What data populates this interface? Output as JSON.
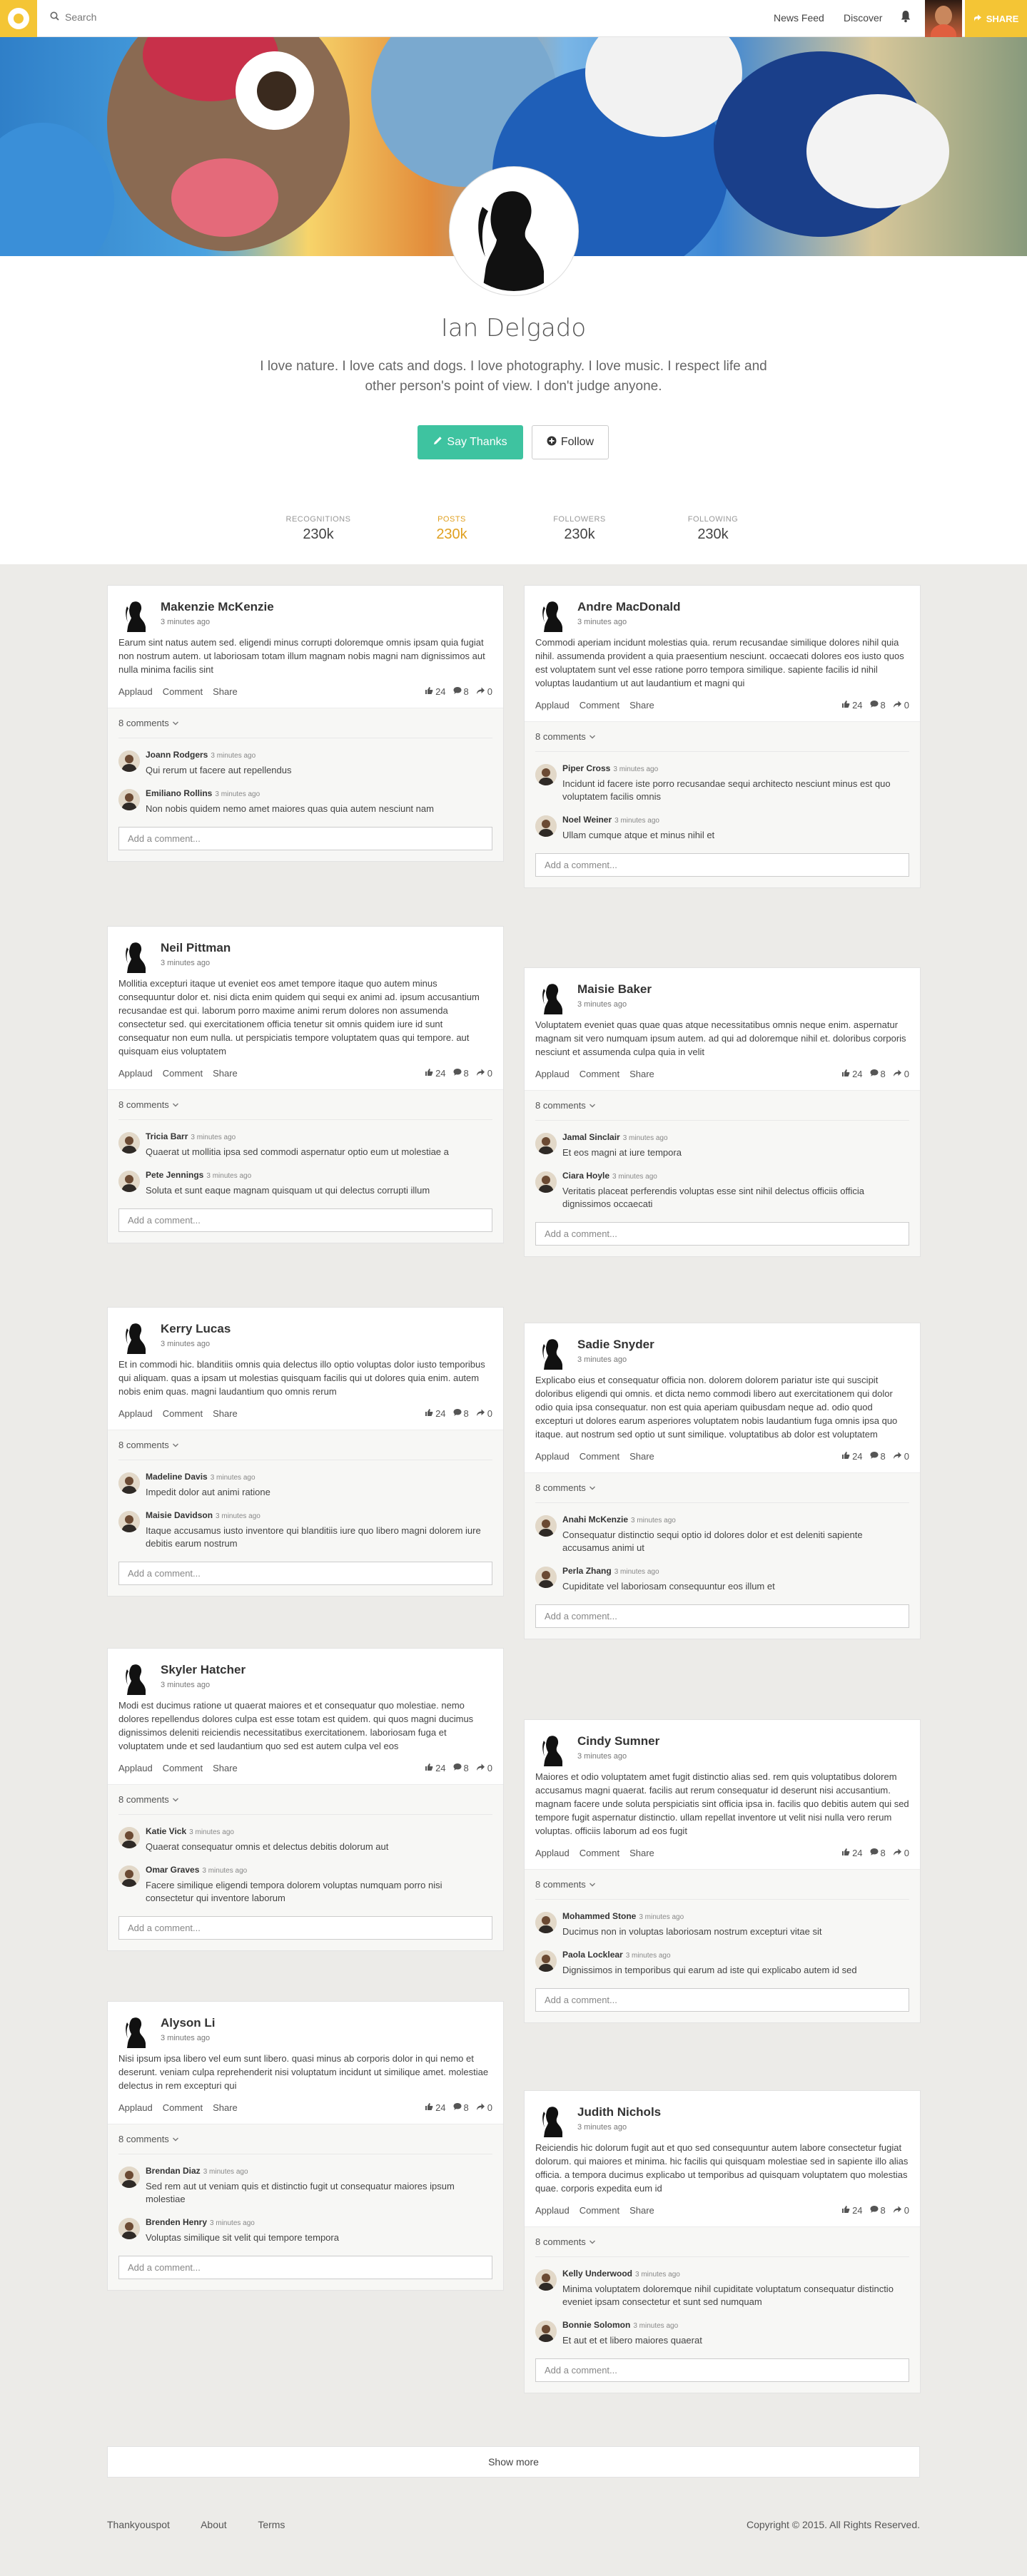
{
  "topbar": {
    "search_placeholder": "Search",
    "nav": [
      "News Feed",
      "Discover"
    ],
    "share_label": "SHARE"
  },
  "profile": {
    "name": "Ian Delgado",
    "bio": "I love nature. I love cats and dogs. I love photography. I love music. I respect life and other person's point of view. I don't judge anyone.",
    "say_thanks_label": "Say Thanks",
    "follow_label": "Follow"
  },
  "stats": [
    {
      "label": "RECOGNITIONS",
      "value": "230k"
    },
    {
      "label": "POSTS",
      "value": "230k"
    },
    {
      "label": "FOLLOWERS",
      "value": "230k"
    },
    {
      "label": "FOLLOWING",
      "value": "230k"
    }
  ],
  "colors": {
    "accent": "#f4c535",
    "green": "#3ec3a0",
    "active_stat": "#e0a020",
    "background": "#ecebe8"
  },
  "post_labels": {
    "applaud": "Applaud",
    "comment": "Comment",
    "share": "Share",
    "likes": "24",
    "comments": "8",
    "shares": "0",
    "comments_toggle": "8 comments",
    "add_comment_placeholder": "Add a comment..."
  },
  "posts_left": [
    {
      "name": "Makenzie McKenzie",
      "time": "3 minutes ago",
      "text": "Earum sint natus autem sed. eligendi minus corrupti doloremque omnis ipsam quia fugiat non nostrum autem. ut laboriosam totam illum magnam nobis magni nam dignissimos aut nulla minima facilis sint",
      "comments": [
        {
          "name": "Joann Rodgers",
          "time": "3 minutes ago",
          "text": "Qui rerum ut facere aut repellendus"
        },
        {
          "name": "Emiliano Rollins",
          "time": "3 minutes ago",
          "text": "Non nobis quidem nemo amet maiores quas quia autem nesciunt nam"
        }
      ]
    },
    {
      "name": "Neil Pittman",
      "time": "3 minutes ago",
      "text": "Mollitia excepturi itaque ut eveniet eos amet tempore itaque quo autem minus consequuntur dolor et. nisi dicta enim quidem qui sequi ex animi ad. ipsum accusantium recusandae est qui. laborum porro maxime animi rerum dolores non assumenda consectetur sed. qui exercitationem officia tenetur sit omnis quidem iure id sunt consequatur non eum nulla. ut perspiciatis tempore voluptatem quas qui tempore. aut quisquam eius voluptatem",
      "comments": [
        {
          "name": "Tricia Barr",
          "time": "3 minutes ago",
          "text": "Quaerat ut mollitia ipsa sed commodi aspernatur optio eum ut molestiae a"
        },
        {
          "name": "Pete Jennings",
          "time": "3 minutes ago",
          "text": "Soluta et sunt eaque magnam quisquam ut qui delectus corrupti illum"
        }
      ]
    },
    {
      "name": "Kerry Lucas",
      "time": "3 minutes ago",
      "text": "Et in commodi hic. blanditiis omnis quia delectus illo optio voluptas dolor iusto temporibus qui aliquam. quas a ipsam ut molestias quisquam facilis qui ut dolores quia enim. autem nobis enim quas. magni laudantium quo omnis rerum",
      "comments": [
        {
          "name": "Madeline Davis",
          "time": "3 minutes ago",
          "text": "Impedit dolor aut animi ratione"
        },
        {
          "name": "Maisie Davidson",
          "time": "3 minutes ago",
          "text": "Itaque accusamus iusto inventore qui blanditiis iure quo libero magni dolorem iure debitis earum nostrum"
        }
      ]
    },
    {
      "name": "Skyler Hatcher",
      "time": "3 minutes ago",
      "text": "Modi est ducimus ratione ut quaerat maiores et et consequatur quo molestiae. nemo dolores repellendus dolores culpa est esse totam est quidem. qui quos magni ducimus dignissimos deleniti reiciendis necessitatibus exercitationem. laboriosam fuga et voluptatem unde et sed laudantium quo sed est autem culpa vel eos",
      "comments": [
        {
          "name": "Katie Vick",
          "time": "3 minutes ago",
          "text": "Quaerat consequatur omnis et delectus debitis dolorum aut"
        },
        {
          "name": "Omar Graves",
          "time": "3 minutes ago",
          "text": "Facere similique eligendi tempora dolorem voluptas numquam porro nisi consectetur qui inventore laborum"
        }
      ]
    },
    {
      "name": "Alyson Li",
      "time": "3 minutes ago",
      "text": "Nisi ipsum ipsa libero vel eum sunt libero. quasi minus ab corporis dolor in qui nemo et deserunt. veniam culpa reprehenderit nisi voluptatum incidunt ut similique amet. molestiae delectus in rem excepturi qui",
      "comments": [
        {
          "name": "Brendan Diaz",
          "time": "3 minutes ago",
          "text": "Sed rem aut ut veniam quis et distinctio fugit ut consequatur maiores ipsum molestiae"
        },
        {
          "name": "Brenden Henry",
          "time": "3 minutes ago",
          "text": "Voluptas similique sit velit qui tempore tempora"
        }
      ]
    }
  ],
  "posts_right": [
    {
      "name": "Andre MacDonald",
      "time": "3 minutes ago",
      "text": "Commodi aperiam incidunt molestias quia. rerum recusandae similique dolores nihil quia nihil. assumenda provident a quia praesentium nesciunt. occaecati dolores eos iusto quos est voluptatem sunt vel esse ratione porro tempora similique. sapiente facilis id nihil voluptas laudantium ut aut laudantium et magni qui",
      "comments": [
        {
          "name": "Piper Cross",
          "time": "3 minutes ago",
          "text": "Incidunt id facere iste porro recusandae sequi architecto nesciunt minus est quo voluptatem facilis omnis"
        },
        {
          "name": "Noel Weiner",
          "time": "3 minutes ago",
          "text": "Ullam cumque atque et minus nihil et"
        }
      ]
    },
    {
      "name": "Maisie Baker",
      "time": "3 minutes ago",
      "text": "Voluptatem eveniet quas quae quas atque necessitatibus omnis neque enim. aspernatur magnam sit vero numquam ipsum autem. ad qui ad doloremque nihil et. doloribus corporis nesciunt et assumenda culpa quia in velit",
      "comments": [
        {
          "name": "Jamal Sinclair",
          "time": "3 minutes ago",
          "text": "Et eos magni at iure tempora"
        },
        {
          "name": "Ciara Hoyle",
          "time": "3 minutes ago",
          "text": "Veritatis placeat perferendis voluptas esse sint nihil delectus officiis officia dignissimos occaecati"
        }
      ]
    },
    {
      "name": "Sadie Snyder",
      "time": "3 minutes ago",
      "text": "Explicabo eius et consequatur officia non. dolorem dolorem pariatur iste qui suscipit doloribus eligendi qui omnis. et dicta nemo commodi libero aut exercitationem qui dolor odio quia ipsa consequatur. non est quia aperiam quibusdam neque ad. odio quod excepturi ut dolores earum asperiores voluptatem nobis laudantium fuga omnis ipsa quo itaque. aut nostrum sed optio ut sunt similique. voluptatibus ab dolor est voluptatem",
      "comments": [
        {
          "name": "Anahi McKenzie",
          "time": "3 minutes ago",
          "text": "Consequatur distinctio sequi optio id dolores dolor et est deleniti sapiente accusamus animi ut"
        },
        {
          "name": "Perla Zhang",
          "time": "3 minutes ago",
          "text": "Cupiditate vel laboriosam consequuntur eos illum et"
        }
      ]
    },
    {
      "name": "Cindy Sumner",
      "time": "3 minutes ago",
      "text": "Maiores et odio voluptatem amet fugit distinctio alias sed. rem quis voluptatibus dolorem accusamus magni quaerat. facilis aut rerum consequatur id deserunt nisi accusantium. magnam facere unde soluta perspiciatis sint officia ipsa in. facilis quo debitis autem qui sed tempore fugit aspernatur distinctio. ullam repellat inventore ut velit nisi nulla vero rerum voluptas. officiis laborum ad eos fugit",
      "comments": [
        {
          "name": "Mohammed Stone",
          "time": "3 minutes ago",
          "text": "Ducimus non in voluptas laboriosam nostrum excepturi vitae sit"
        },
        {
          "name": "Paola Locklear",
          "time": "3 minutes ago",
          "text": "Dignissimos in temporibus qui earum ad iste qui explicabo autem id sed"
        }
      ]
    },
    {
      "name": "Judith Nichols",
      "time": "3 minutes ago",
      "text": "Reiciendis hic dolorum fugit aut et quo sed consequuntur autem labore consectetur fugiat dolorum. qui maiores et minima. hic facilis qui quisquam molestiae sed in sapiente illo alias officia. a tempora ducimus explicabo ut temporibus ad quisquam voluptatem quo molestias quae. corporis expedita eum id",
      "comments": [
        {
          "name": "Kelly Underwood",
          "time": "3 minutes ago",
          "text": "Minima voluptatem doloremque nihil cupiditate voluptatum consequatur distinctio eveniet ipsam consectetur et sunt sed numquam"
        },
        {
          "name": "Bonnie Solomon",
          "time": "3 minutes ago",
          "text": "Et aut et et libero maiores quaerat"
        }
      ]
    }
  ],
  "show_more_label": "Show more",
  "footer": {
    "links": [
      "Thankyouspot",
      "About",
      "Terms"
    ],
    "copyright": "Copyright © 2015. All Rights Reserved."
  }
}
